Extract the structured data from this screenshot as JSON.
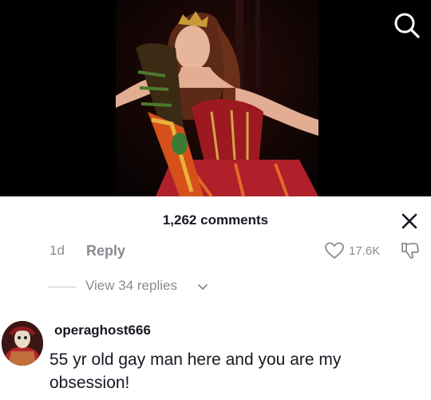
{
  "video": {
    "image_desc": "woman in red corseted gown with gold crown and colorful scarf singing on stage"
  },
  "icons": {
    "search": "search-icon",
    "close": "close-icon",
    "like": "heart-icon",
    "dislike": "dislike-icon",
    "chevron": "chevron-down-icon"
  },
  "sheet": {
    "comment_count_label": "1,262 comments"
  },
  "prev_comment": {
    "time": "1d",
    "reply_label": "Reply",
    "likes": "17.6K"
  },
  "replies": {
    "label": "View 34 replies"
  },
  "comment": {
    "username": "operaghost666",
    "text": "55 yr old gay man here and you are my obsession!"
  },
  "colors": {
    "muted": "#8a8b91",
    "primary_text": "#161823",
    "background": "#ffffff"
  }
}
